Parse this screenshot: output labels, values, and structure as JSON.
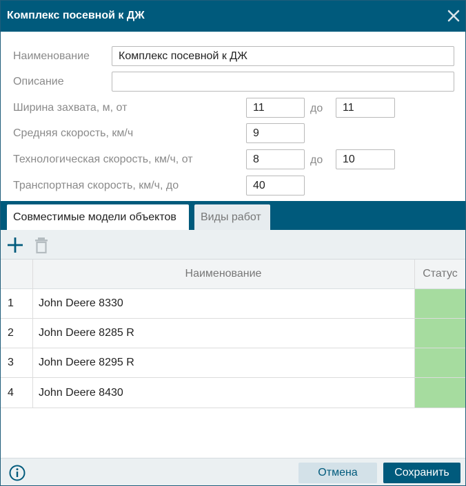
{
  "dialog": {
    "title": "Комплекс посевной к ДЖ",
    "close_icon": "close-icon"
  },
  "form": {
    "name_label": "Наименование",
    "name_value": "Комплекс посевной к ДЖ",
    "description_label": "Описание",
    "description_value": "",
    "width_label": "Ширина захвата, м, от",
    "width_from": "11",
    "width_to": "11",
    "avg_speed_label": "Средняя скорость, км/ч",
    "avg_speed_value": "9",
    "tech_speed_label": "Технологическая скорость, км/ч, от",
    "tech_speed_from": "8",
    "tech_speed_to": "10",
    "transport_speed_label": "Транспортная скорость, км/ч, до",
    "transport_speed_value": "40",
    "to_word": "до"
  },
  "tabs": [
    {
      "label": "Совместимые модели объектов",
      "active": true
    },
    {
      "label": "Виды работ",
      "active": false
    }
  ],
  "toolbar": {
    "add_icon": "plus-icon",
    "delete_icon": "trash-icon"
  },
  "grid": {
    "columns": [
      "",
      "Наименование",
      "Статус"
    ],
    "rows": [
      {
        "num": "1",
        "name": "John Deere 8330",
        "status_color": "#a6dc9f"
      },
      {
        "num": "2",
        "name": "John Deere 8285 R",
        "status_color": "#a6dc9f"
      },
      {
        "num": "3",
        "name": "John Deere 8295 R",
        "status_color": "#a6dc9f"
      },
      {
        "num": "4",
        "name": "John Deere 8430",
        "status_color": "#a6dc9f"
      }
    ]
  },
  "footer": {
    "info_icon": "info-icon",
    "cancel_label": "Отмена",
    "save_label": "Сохранить"
  },
  "colors": {
    "brand": "#005a7c",
    "status_ok": "#a6dc9f"
  }
}
